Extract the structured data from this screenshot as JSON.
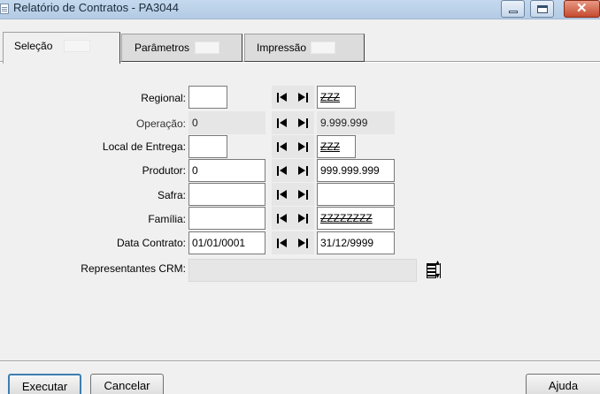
{
  "window": {
    "title": "Relatório de Contratos - PA3044"
  },
  "tabs": [
    {
      "label": "Seleção",
      "active": true
    },
    {
      "label": "Parâmetros",
      "active": false
    },
    {
      "label": "Impressão",
      "active": false
    }
  ],
  "form": {
    "regional": {
      "label": "Regional:",
      "from": "",
      "to": "ZZZ"
    },
    "operacao": {
      "label": "Operação:",
      "from": "0",
      "to": "9.999.999"
    },
    "local_entrega": {
      "label": "Local de Entrega:",
      "from": "",
      "to": "ZZZ"
    },
    "produtor": {
      "label": "Produtor:",
      "from": "0",
      "to": "999.999.999"
    },
    "safra": {
      "label": "Safra:",
      "from": "",
      "to": ""
    },
    "familia": {
      "label": "Família:",
      "from": "",
      "to": "ZZZZZZZZ"
    },
    "data_contrato": {
      "label": "Data Contrato:",
      "from": "01/01/0001",
      "to": "31/12/9999"
    },
    "representantes_crm": {
      "label": "Representantes CRM:",
      "value": ""
    }
  },
  "buttons": {
    "executar": "Executar",
    "cancelar": "Cancelar",
    "ajuda": "Ajuda"
  },
  "icons": {
    "first": "first-record-icon",
    "last": "last-record-icon",
    "list": "list-selector-icon"
  }
}
